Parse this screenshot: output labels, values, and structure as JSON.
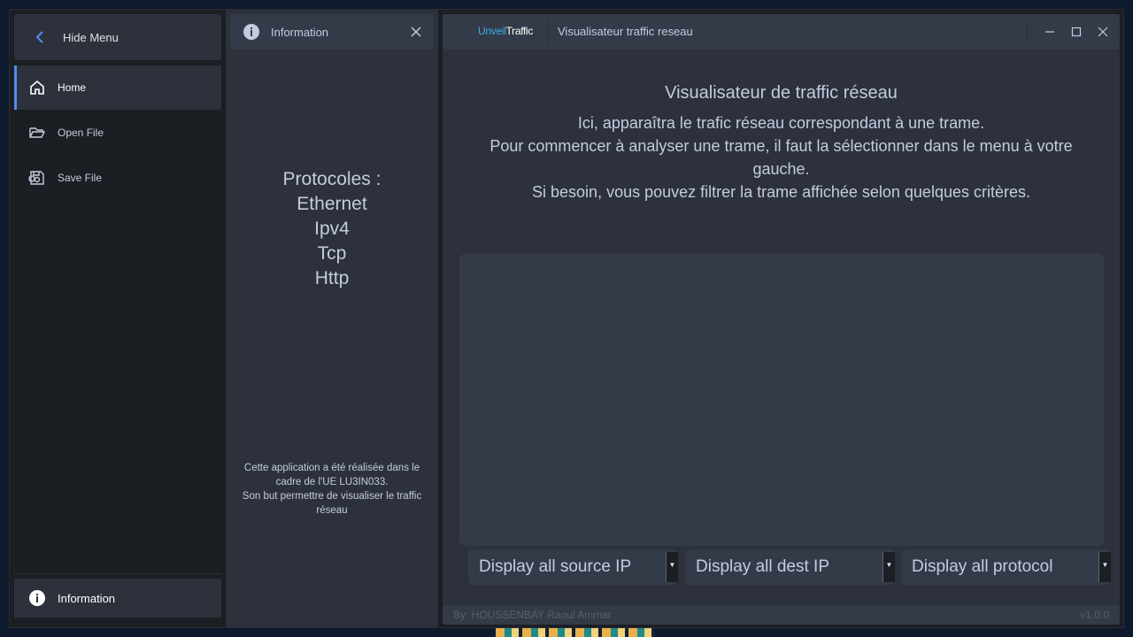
{
  "menu": {
    "toggle_label": "Hide Menu",
    "items": [
      {
        "label": "Home",
        "icon": "home-icon"
      },
      {
        "label": "Open File",
        "icon": "folder-open-icon"
      },
      {
        "label": "Save File",
        "icon": "save-icon"
      }
    ],
    "info_label": "Information"
  },
  "info_panel": {
    "title": "Information",
    "protocols_title": "Protocoles :",
    "protocols": [
      "Ethernet",
      "Ipv4",
      "Tcp",
      "Http"
    ],
    "about_lines": [
      "Cette application a été réalisée dans le cadre de l'UE LU3IN033.",
      "Son but permettre de visualiser le traffic réseau"
    ]
  },
  "titlebar": {
    "logo_part1": "Unveil",
    "logo_part2": "Traffic",
    "title": "Visualisateur traffic reseau"
  },
  "main": {
    "heading": "Visualisateur de traffic réseau",
    "desc_lines": [
      "Ici, apparaîtra le trafic réseau correspondant à une trame.",
      "Pour commencer à analyser une trame, il faut la sélectionner dans le menu à votre gauche.",
      "Si besoin, vous pouvez filtrer la trame affichée selon quelques critères."
    ],
    "filters": {
      "source_ip": "Display all source IP",
      "dest_ip": "Display all dest IP",
      "protocol": "Display all protocol"
    }
  },
  "footer": {
    "credit": "By: HOUSSENBAY Raoul Ammar",
    "version": "v1.0.0"
  },
  "colors": {
    "accent": "#568af2",
    "logo_blue": "#3da9e8",
    "panel": "#2c313c",
    "panel_light": "#343b48",
    "dark": "#1b1e23"
  }
}
